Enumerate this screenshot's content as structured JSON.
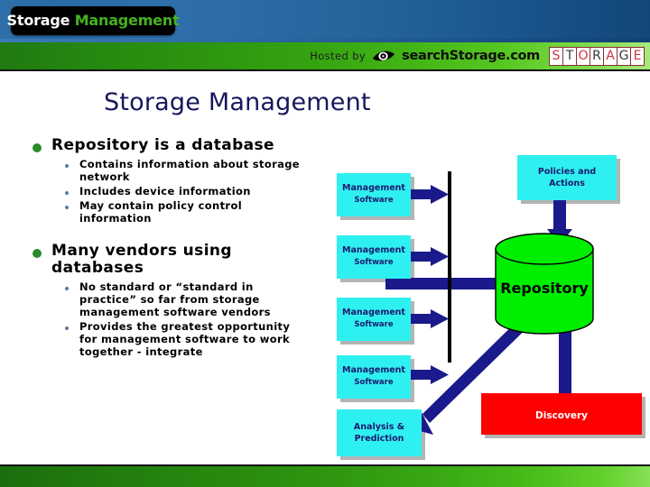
{
  "header": {
    "logo": {
      "word1": "Storage",
      "word2": "Management"
    },
    "hosted_by_label": "Hosted by",
    "sponsor_name": "searchStorage.com",
    "sponsor_mark_letters": [
      "S",
      "T",
      "O",
      "R",
      "A",
      "G",
      "E"
    ],
    "eye_icon": "eye-icon",
    "colors": {
      "logo_word2": "#46b321",
      "banner_blue": "#2a6ba6",
      "banner_green": "#35a310",
      "mark_red": "#d03040",
      "mark_dark": "#3a3a3a"
    }
  },
  "slide": {
    "title": "Storage Management",
    "title_color": "#17175c",
    "bullets": [
      {
        "text": "Repository is a database",
        "marker": "green-disc",
        "marker_color": "#2d8a2d",
        "sub_bullets": [
          "Contains information about storage network",
          "Includes device information",
          "May contain policy control information"
        ]
      },
      {
        "text": "Many vendors using databases",
        "marker": "green-disc",
        "marker_color": "#2d8a2d",
        "sub_bullets": [
          "No standard or “standard in practice” so far from storage management software vendors",
          "Provides the greatest opportunity for management software to work together - integrate"
        ]
      }
    ]
  },
  "diagram": {
    "colors": {
      "box_cyan": "#2ff0f0",
      "box_red": "#fe0000",
      "cylinder_green": "#00ee00",
      "arrow_navy": "#1a1a8c",
      "bar_black": "#000000",
      "shadow_gray": "#b4b4b4",
      "box_text_navy": "#1a1a6e",
      "red_box_text": "#ffffff"
    },
    "nodes": [
      {
        "id": "mgmt1",
        "label": "Management Software",
        "shape": "rect",
        "fill": "#2ff0f0"
      },
      {
        "id": "mgmt2",
        "label": "Management Software",
        "shape": "rect",
        "fill": "#2ff0f0"
      },
      {
        "id": "mgmt3",
        "label": "Management Software",
        "shape": "rect",
        "fill": "#2ff0f0"
      },
      {
        "id": "mgmt4",
        "label": "Management Software",
        "shape": "rect",
        "fill": "#2ff0f0"
      },
      {
        "id": "analysis",
        "label": "Analysis & Prediction",
        "shape": "rect",
        "fill": "#2ff0f0"
      },
      {
        "id": "policies",
        "label": "Policies and Actions",
        "shape": "rect",
        "fill": "#2ff0f0"
      },
      {
        "id": "repository",
        "label": "Repository",
        "shape": "cylinder",
        "fill": "#00ee00"
      },
      {
        "id": "discovery",
        "label": "Discovery",
        "shape": "rect",
        "fill": "#fe0000"
      }
    ],
    "edges": [
      {
        "from": "mgmt1",
        "to": "bus",
        "type": "single"
      },
      {
        "from": "mgmt2",
        "to": "bus",
        "type": "single"
      },
      {
        "from": "mgmt3",
        "to": "bus",
        "type": "single"
      },
      {
        "from": "mgmt4",
        "to": "bus",
        "type": "single"
      },
      {
        "from": "bus",
        "to": "repository",
        "type": "single"
      },
      {
        "from": "analysis",
        "to": "repository",
        "type": "double-diagonal"
      },
      {
        "from": "discovery",
        "to": "repository",
        "type": "single-up"
      },
      {
        "from": "policies",
        "to": "repository",
        "type": "double-vertical"
      }
    ],
    "labels": {
      "management_software_line1": "Management",
      "management_software_line2": "Software",
      "analysis_line1": "Analysis &",
      "analysis_line2": "Prediction",
      "policies_line1": "Policies and",
      "policies_line2": "Actions",
      "repository": "Repository",
      "discovery": "Discovery"
    }
  }
}
